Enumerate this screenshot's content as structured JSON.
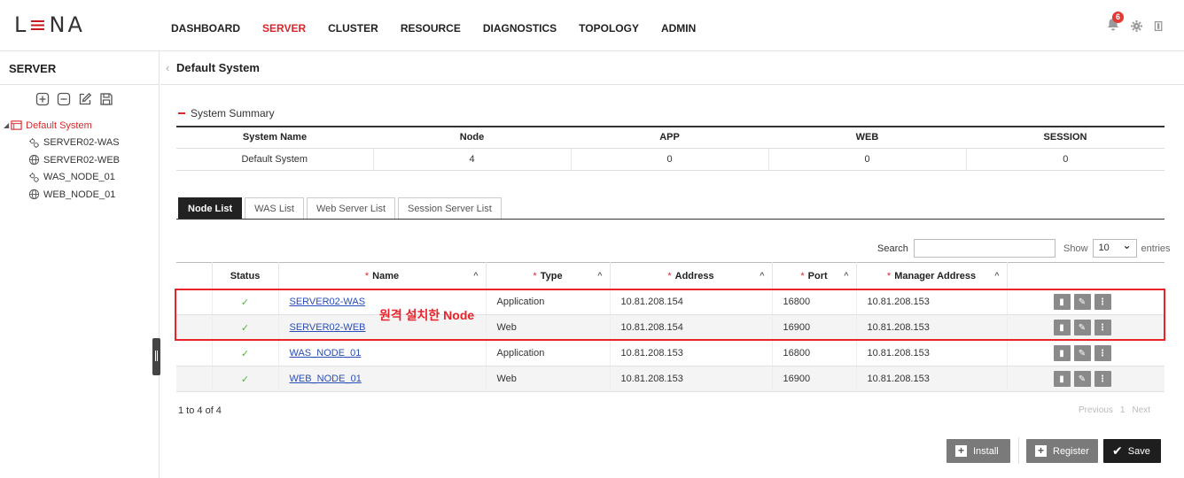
{
  "header": {
    "logo_left": "L",
    "logo_bars": "≡",
    "logo_right": "NA",
    "nav": [
      "DASHBOARD",
      "SERVER",
      "CLUSTER",
      "RESOURCE",
      "DIAGNOSTICS",
      "TOPOLOGY",
      "ADMIN"
    ],
    "active_nav": "SERVER",
    "notification_count": "6"
  },
  "sidebar": {
    "title": "SERVER",
    "tree_root": "Default System",
    "tree_items": [
      "SERVER02-WAS",
      "SERVER02-WEB",
      "WAS_NODE_01",
      "WEB_NODE_01"
    ],
    "tree_icons": [
      "was-icon",
      "web-icon",
      "was-icon",
      "web-icon"
    ]
  },
  "page": {
    "title": "Default System",
    "summary_title": "System Summary"
  },
  "summary": {
    "headers": [
      "System Name",
      "Node",
      "APP",
      "WEB",
      "SESSION"
    ],
    "row": [
      "Default System",
      "4",
      "0",
      "0",
      "0"
    ]
  },
  "tabs": [
    "Node List",
    "WAS List",
    "Web Server List",
    "Session Server List"
  ],
  "list_controls": {
    "search_label": "Search",
    "show_label": "Show",
    "entries_value": "10",
    "entries_label": "entries"
  },
  "nodes": {
    "headers": [
      "Status",
      "Name",
      "Type",
      "Address",
      "Port",
      "Manager Address",
      ""
    ],
    "rows": [
      {
        "name": "SERVER02-WAS",
        "type": "Application",
        "address": "10.81.208.154",
        "port": "16800",
        "manager": "10.81.208.153"
      },
      {
        "name": "SERVER02-WEB",
        "type": "Web",
        "address": "10.81.208.154",
        "port": "16900",
        "manager": "10.81.208.153"
      },
      {
        "name": "WAS_NODE_01",
        "type": "Application",
        "address": "10.81.208.153",
        "port": "16800",
        "manager": "10.81.208.153"
      },
      {
        "name": "WEB_NODE_01",
        "type": "Web",
        "address": "10.81.208.153",
        "port": "16900",
        "manager": "10.81.208.153"
      }
    ],
    "status_symbol": "✓"
  },
  "annotation": "원격 설치한 Node",
  "paging": {
    "info": "1 to 4 of 4",
    "previous": "Previous",
    "page": "1",
    "next": "Next"
  },
  "buttons": {
    "install": "Install",
    "register": "Register",
    "save": "Save"
  },
  "colors": {
    "accent_red": "#d9262b",
    "status_green": "#53b33d",
    "link_blue": "#2a4db7"
  }
}
